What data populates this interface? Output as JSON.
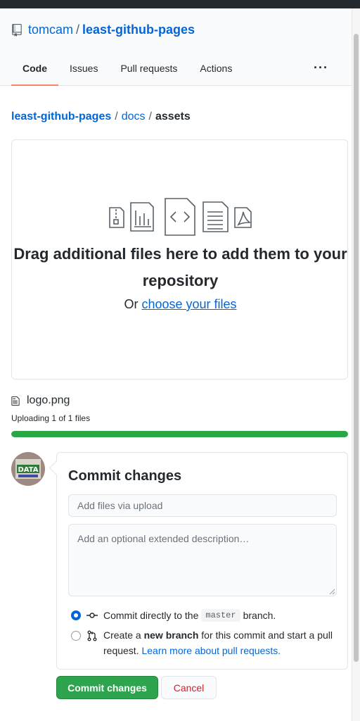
{
  "repo": {
    "owner": "tomcam",
    "separator": "/",
    "name": "least-github-pages"
  },
  "tabs": [
    {
      "label": "Code",
      "active": true
    },
    {
      "label": "Issues",
      "active": false
    },
    {
      "label": "Pull requests",
      "active": false
    },
    {
      "label": "Actions",
      "active": false
    }
  ],
  "more_label": "···",
  "breadcrumb": {
    "root": "least-github-pages",
    "sep": "/",
    "folder": "docs",
    "current": "assets"
  },
  "dropzone": {
    "title": "Drag additional files here to add them to your repository",
    "or_text": "Or",
    "choose_link": "choose your files"
  },
  "upload": {
    "file_name": "logo.png",
    "status": "Uploading 1 of 1 files",
    "progress": 1.0
  },
  "commit": {
    "title": "Commit changes",
    "summary_placeholder": "Add files via upload",
    "description_placeholder": "Add an optional extended description…",
    "option_direct": {
      "prefix": "Commit directly to the",
      "branch": "master",
      "suffix": "branch."
    },
    "option_new_branch": {
      "prefix": "Create a",
      "bold": "new branch",
      "suffix": "for this commit and start a pull request.",
      "link": "Learn more about pull requests."
    },
    "submit_label": "Commit changes",
    "cancel_label": "Cancel"
  },
  "colors": {
    "link": "#0366d6",
    "accent_tab": "#f9826c",
    "progress": "#28a745",
    "primary_button": "#2ea44f",
    "danger": "#cb2431"
  },
  "icons": [
    "repo-icon",
    "zip-file-icon",
    "chart-file-icon",
    "code-file-icon",
    "text-file-icon",
    "pdf-file-icon",
    "file-icon",
    "git-commit-icon",
    "git-pull-request-icon"
  ]
}
